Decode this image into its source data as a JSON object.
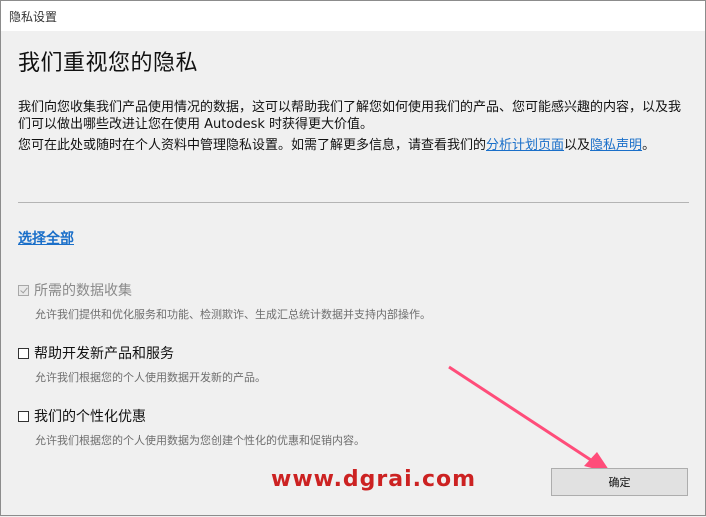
{
  "window": {
    "title": "隐私设置"
  },
  "heading": "我们重视您的隐私",
  "paragraph1": "我们向您收集我们产品使用情况的数据，这可以帮助我们了解您如何使用我们的产品、您可能感兴趣的内容，以及我们可以做出哪些改进让您在使用 Autodesk 时获得更大价值。",
  "paragraph2": {
    "text_before": "您可在此处或随时在个人资料中管理隐私设置。如需了解更多信息，请查看我们的",
    "link1": "分析计划页面",
    "text_middle": "以及",
    "link2": "隐私声明",
    "text_after": "。"
  },
  "select_all": "选择全部",
  "options": [
    {
      "label": "所需的数据收集",
      "description": "允许我们提供和优化服务和功能、检测欺诈、生成汇总统计数据并支持内部操作。",
      "checked": true,
      "disabled": true
    },
    {
      "label": "帮助开发新产品和服务",
      "description": "允许我们根据您的个人使用数据开发新的产品。",
      "checked": false,
      "disabled": false
    },
    {
      "label": "我们的个性化优惠",
      "description": "允许我们根据您的个人使用数据为您创建个性化的优惠和促销内容。",
      "checked": false,
      "disabled": false
    }
  ],
  "ok_button": "确定",
  "watermark": "www.dgrai.com",
  "colors": {
    "link": "#1a6fc9",
    "arrow": "#ff4d7a",
    "watermark": "#cc2222"
  }
}
